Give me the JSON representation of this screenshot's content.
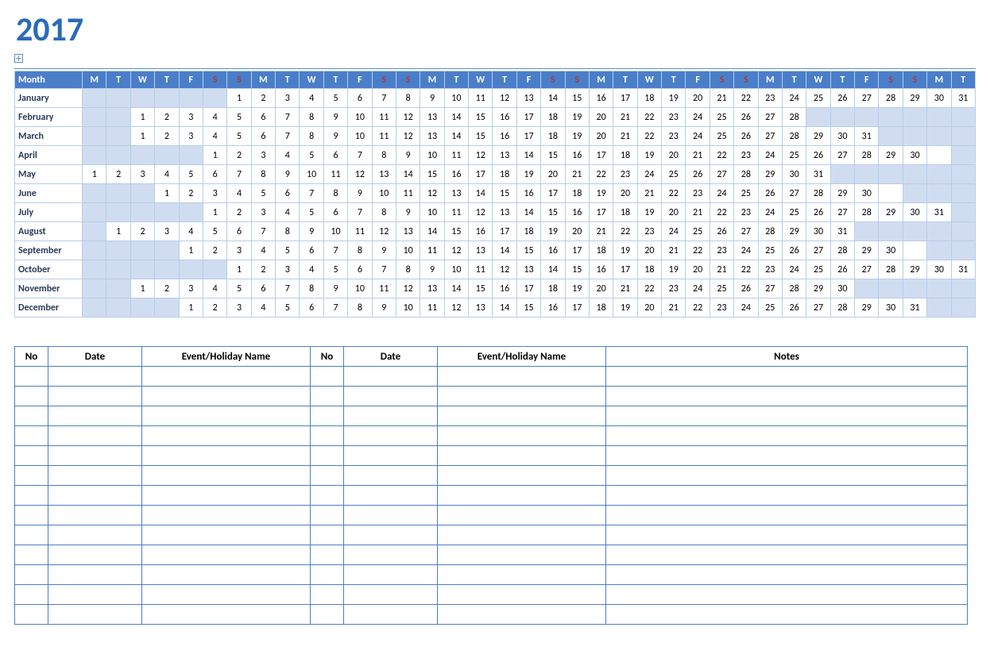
{
  "title": "2017",
  "day_headers": [
    "M",
    "T",
    "W",
    "T",
    "F",
    "S",
    "S",
    "M",
    "T",
    "W",
    "T",
    "F",
    "S",
    "S",
    "M",
    "T",
    "W",
    "T",
    "F",
    "S",
    "S",
    "M",
    "T",
    "W",
    "T",
    "F",
    "S",
    "S",
    "M",
    "T",
    "W",
    "T",
    "F",
    "S",
    "S",
    "M",
    "T"
  ],
  "day_weekend_idx": [
    5,
    6,
    12,
    13,
    19,
    20,
    26,
    27,
    33,
    34
  ],
  "month_header": "Month",
  "months": [
    {
      "name": "January",
      "start": 6,
      "days": 31
    },
    {
      "name": "February",
      "start": 2,
      "days": 28
    },
    {
      "name": "March",
      "start": 2,
      "days": 31
    },
    {
      "name": "April",
      "start": 5,
      "days": 30,
      "extra_trail": 1
    },
    {
      "name": "May",
      "start": 0,
      "days": 31
    },
    {
      "name": "June",
      "start": 3,
      "days": 30,
      "extra_trail": 1
    },
    {
      "name": "July",
      "start": 5,
      "days": 31
    },
    {
      "name": "August",
      "start": 1,
      "days": 31
    },
    {
      "name": "September",
      "start": 4,
      "days": 30,
      "extra_trail": 1
    },
    {
      "name": "October",
      "start": 6,
      "days": 31
    },
    {
      "name": "November",
      "start": 2,
      "days": 30
    },
    {
      "name": "December",
      "start": 4,
      "days": 31
    }
  ],
  "events_table": {
    "headers": [
      "No",
      "Date",
      "Event/Holiday Name",
      "No",
      "Date",
      "Event/Holiday Name",
      "Notes"
    ],
    "blank_rows": 13
  }
}
